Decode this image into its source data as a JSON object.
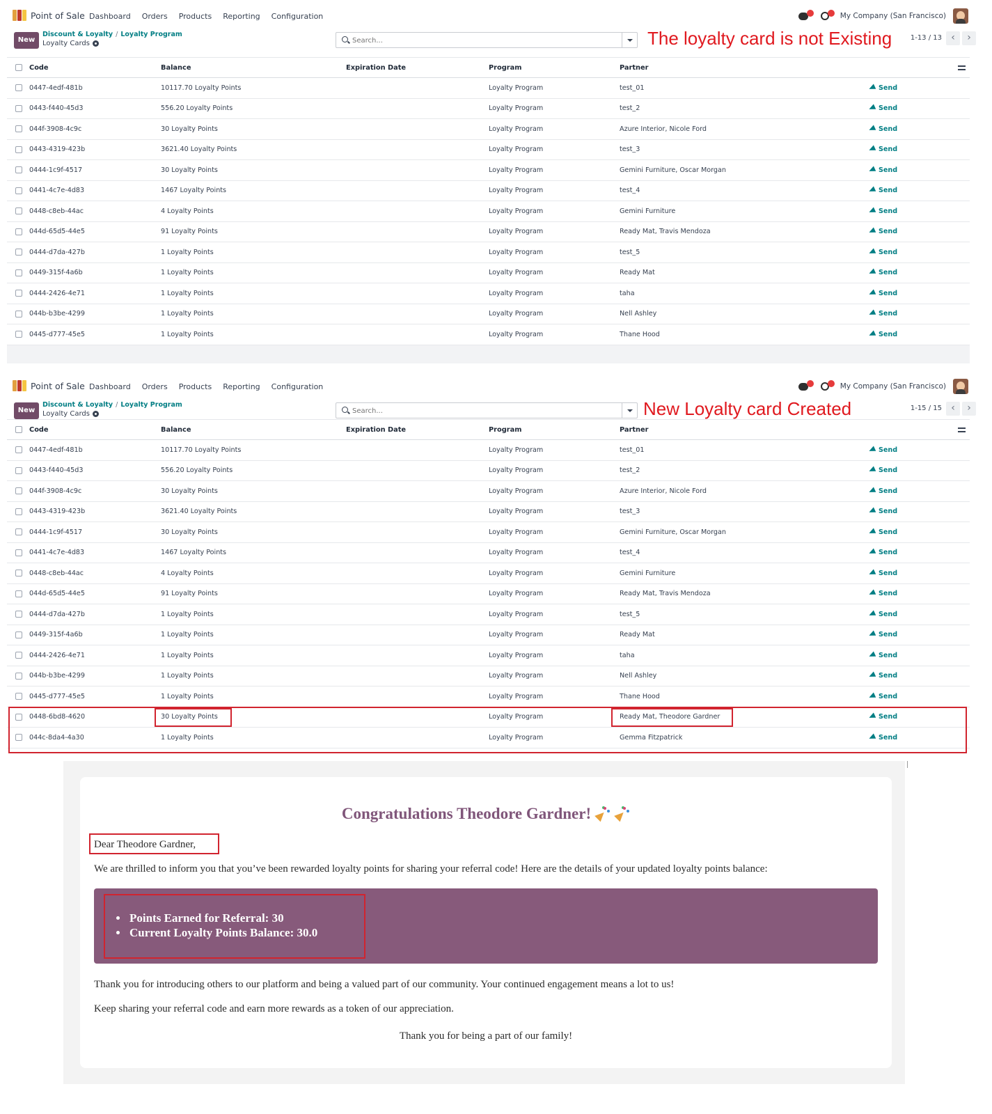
{
  "colors": {
    "brand": "#714b67",
    "link": "#017e84",
    "annotation": "#e0191f",
    "email_box": "#875a7b",
    "email_title": "#80567a"
  },
  "navbar": {
    "app_name": "Point of Sale",
    "menu": [
      "Dashboard",
      "Orders",
      "Products",
      "Reporting",
      "Configuration"
    ],
    "company": "My Company (San Francisco)",
    "icons": [
      "discuss-chat-icon",
      "activity-clock-icon",
      "user-avatar"
    ]
  },
  "control": {
    "new_label": "New",
    "breadcrumb_parent": "Discount & Loyalty",
    "breadcrumb_sep": "/",
    "breadcrumb_current": "Loyalty Program",
    "subtitle": "Loyalty Cards",
    "search_placeholder": "Search..."
  },
  "columns": [
    "Code",
    "Balance",
    "Expiration Date",
    "Program",
    "Partner"
  ],
  "send_label": "Send",
  "panel1": {
    "annotation": "The loyalty card is not Existing",
    "pager": "1-13 / 13",
    "rows": [
      {
        "code": "0447-4edf-481b",
        "balance": "10117.70 Loyalty Points",
        "expiration": "",
        "program": "Loyalty Program",
        "partner": "test_01"
      },
      {
        "code": "0443-f440-45d3",
        "balance": "556.20 Loyalty Points",
        "expiration": "",
        "program": "Loyalty Program",
        "partner": "test_2"
      },
      {
        "code": "044f-3908-4c9c",
        "balance": "30 Loyalty Points",
        "expiration": "",
        "program": "Loyalty Program",
        "partner": "Azure Interior, Nicole Ford"
      },
      {
        "code": "0443-4319-423b",
        "balance": "3621.40 Loyalty Points",
        "expiration": "",
        "program": "Loyalty Program",
        "partner": "test_3"
      },
      {
        "code": "0444-1c9f-4517",
        "balance": "30 Loyalty Points",
        "expiration": "",
        "program": "Loyalty Program",
        "partner": "Gemini Furniture, Oscar Morgan"
      },
      {
        "code": "0441-4c7e-4d83",
        "balance": "1467 Loyalty Points",
        "expiration": "",
        "program": "Loyalty Program",
        "partner": "test_4"
      },
      {
        "code": "0448-c8eb-44ac",
        "balance": "4 Loyalty Points",
        "expiration": "",
        "program": "Loyalty Program",
        "partner": "Gemini Furniture"
      },
      {
        "code": "044d-65d5-44e5",
        "balance": "91 Loyalty Points",
        "expiration": "",
        "program": "Loyalty Program",
        "partner": "Ready Mat, Travis Mendoza"
      },
      {
        "code": "0444-d7da-427b",
        "balance": "1 Loyalty Points",
        "expiration": "",
        "program": "Loyalty Program",
        "partner": "test_5"
      },
      {
        "code": "0449-315f-4a6b",
        "balance": "1 Loyalty Points",
        "expiration": "",
        "program": "Loyalty Program",
        "partner": "Ready Mat"
      },
      {
        "code": "0444-2426-4e71",
        "balance": "1 Loyalty Points",
        "expiration": "",
        "program": "Loyalty Program",
        "partner": "taha"
      },
      {
        "code": "044b-b3be-4299",
        "balance": "1 Loyalty Points",
        "expiration": "",
        "program": "Loyalty Program",
        "partner": "Nell Ashley"
      },
      {
        "code": "0445-d777-45e5",
        "balance": "1 Loyalty Points",
        "expiration": "",
        "program": "Loyalty Program",
        "partner": "Thane Hood"
      }
    ]
  },
  "panel2": {
    "annotation": "New Loyalty card Created",
    "pager": "1-15 / 15",
    "rows": [
      {
        "code": "0447-4edf-481b",
        "balance": "10117.70 Loyalty Points",
        "expiration": "",
        "program": "Loyalty Program",
        "partner": "test_01"
      },
      {
        "code": "0443-f440-45d3",
        "balance": "556.20 Loyalty Points",
        "expiration": "",
        "program": "Loyalty Program",
        "partner": "test_2"
      },
      {
        "code": "044f-3908-4c9c",
        "balance": "30 Loyalty Points",
        "expiration": "",
        "program": "Loyalty Program",
        "partner": "Azure Interior, Nicole Ford"
      },
      {
        "code": "0443-4319-423b",
        "balance": "3621.40 Loyalty Points",
        "expiration": "",
        "program": "Loyalty Program",
        "partner": "test_3"
      },
      {
        "code": "0444-1c9f-4517",
        "balance": "30 Loyalty Points",
        "expiration": "",
        "program": "Loyalty Program",
        "partner": "Gemini Furniture, Oscar Morgan"
      },
      {
        "code": "0441-4c7e-4d83",
        "balance": "1467 Loyalty Points",
        "expiration": "",
        "program": "Loyalty Program",
        "partner": "test_4"
      },
      {
        "code": "0448-c8eb-44ac",
        "balance": "4 Loyalty Points",
        "expiration": "",
        "program": "Loyalty Program",
        "partner": "Gemini Furniture"
      },
      {
        "code": "044d-65d5-44e5",
        "balance": "91 Loyalty Points",
        "expiration": "",
        "program": "Loyalty Program",
        "partner": "Ready Mat, Travis Mendoza"
      },
      {
        "code": "0444-d7da-427b",
        "balance": "1 Loyalty Points",
        "expiration": "",
        "program": "Loyalty Program",
        "partner": "test_5"
      },
      {
        "code": "0449-315f-4a6b",
        "balance": "1 Loyalty Points",
        "expiration": "",
        "program": "Loyalty Program",
        "partner": "Ready Mat"
      },
      {
        "code": "0444-2426-4e71",
        "balance": "1 Loyalty Points",
        "expiration": "",
        "program": "Loyalty Program",
        "partner": "taha"
      },
      {
        "code": "044b-b3be-4299",
        "balance": "1 Loyalty Points",
        "expiration": "",
        "program": "Loyalty Program",
        "partner": "Nell Ashley"
      },
      {
        "code": "0445-d777-45e5",
        "balance": "1 Loyalty Points",
        "expiration": "",
        "program": "Loyalty Program",
        "partner": "Thane Hood"
      },
      {
        "code": "0448-6bd8-4620",
        "balance": "30 Loyalty Points",
        "expiration": "",
        "program": "Loyalty Program",
        "partner": "Ready Mat, Theodore Gardner"
      },
      {
        "code": "044c-8da4-4a30",
        "balance": "1 Loyalty Points",
        "expiration": "",
        "program": "Loyalty Program",
        "partner": "Gemma Fitzpatrick"
      }
    ]
  },
  "email": {
    "title": "Congratulations Theodore Gardner!",
    "greeting": "Dear Theodore Gardner,",
    "intro": "We are thrilled to inform you that you’ve been rewarded loyalty points for sharing your referral code! Here are the details of your updated loyalty points balance:",
    "points_earned": "Points Earned for Referral: 30",
    "current_balance": "Current Loyalty Points Balance: 30.0",
    "thanks": "Thank you for introducing others to our platform and being a valued part of our community. Your continued engagement means a lot to us!",
    "keep_sharing": "Keep sharing your referral code and earn more rewards as a token of our appreciation.",
    "closing": "Thank you for being a part of our family!"
  }
}
